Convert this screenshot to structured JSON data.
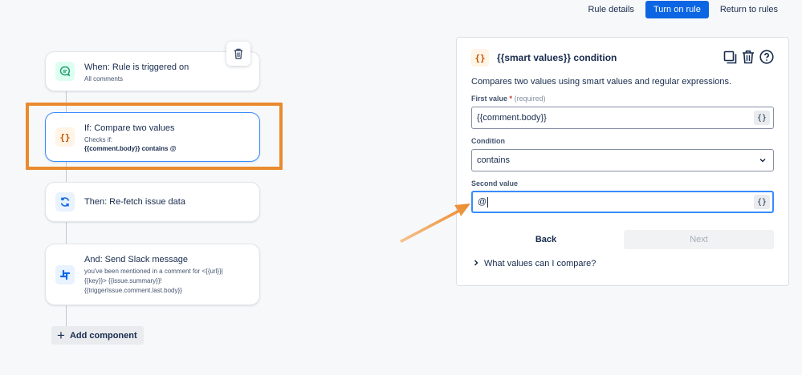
{
  "topbar": {
    "rule_details": "Rule details",
    "turn_on_rule": "Turn on rule",
    "return_to_rules": "Return to rules"
  },
  "flow": {
    "cards": [
      {
        "title": "When: Rule is triggered on",
        "sub": "All comments",
        "icon": "comment-icon"
      },
      {
        "title": "If: Compare two values",
        "sub_line1": "Checks if:",
        "sub_line2": "{{comment.body}} contains @",
        "icon": "curly-braces-icon"
      },
      {
        "title": "Then: Re-fetch issue data",
        "icon": "refresh-icon"
      },
      {
        "title": "And: Send Slack message",
        "sub_line1": "you've been mentioned in a comment for <{{url}}|",
        "sub_line2": "{{key}}> {{issue.summary}}!",
        "sub_line3": "{{triggerIssue.comment.last.body}}",
        "icon": "slack-icon"
      }
    ],
    "add_component": "Add component"
  },
  "panel": {
    "title": "{{smart values}} condition",
    "description": "Compares two values using smart values and regular expressions.",
    "first_value_label": "First value",
    "required_mark": "*",
    "required_hint": "(required)",
    "first_value": "{{comment.body}}",
    "condition_label": "Condition",
    "condition_value": "contains",
    "second_value_label": "Second value",
    "second_value": "@",
    "brace_glyph": "{}",
    "back": "Back",
    "next": "Next",
    "help": "What values can I compare?"
  },
  "colors": {
    "accent": "#0c66e4",
    "highlight": "#ea8a2e",
    "focus": "#388bff"
  }
}
